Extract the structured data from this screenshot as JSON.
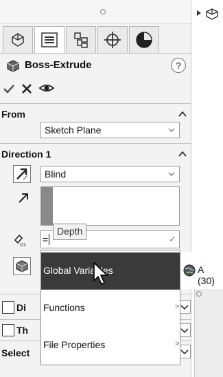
{
  "panel": {
    "feature_title": "Boss-Extrude",
    "help_label": "?",
    "tabs": [
      {
        "icon": "feature-manager-icon"
      },
      {
        "icon": "property-manager-icon"
      },
      {
        "icon": "configuration-manager-icon"
      },
      {
        "icon": "dimxpert-icon"
      },
      {
        "icon": "display-manager-icon"
      }
    ],
    "actions": {
      "ok_icon": "checkmark-icon",
      "cancel_icon": "close-icon",
      "preview_icon": "eye-icon"
    }
  },
  "from": {
    "title": "From",
    "selected": "Sketch Plane"
  },
  "direction1": {
    "title": "Direction 1",
    "end_condition": "Blind",
    "depth_prefix": "=",
    "depth_tooltip": "Depth"
  },
  "menu": {
    "items": [
      {
        "label": "Global Variables",
        "arrow": "",
        "highlighted": true
      },
      {
        "label": "Functions",
        "arrow": ">",
        "highlighted": false
      },
      {
        "label": "File Properties",
        "arrow": ">",
        "highlighted": false
      }
    ],
    "submenu_item": "A (30)"
  },
  "hidden_rows": {
    "row1": "Di",
    "row2": "Th",
    "row3": "Select"
  },
  "colors": {
    "menu_highlight": "#3a3a3a",
    "panel_bg": "#f3f3f3"
  }
}
